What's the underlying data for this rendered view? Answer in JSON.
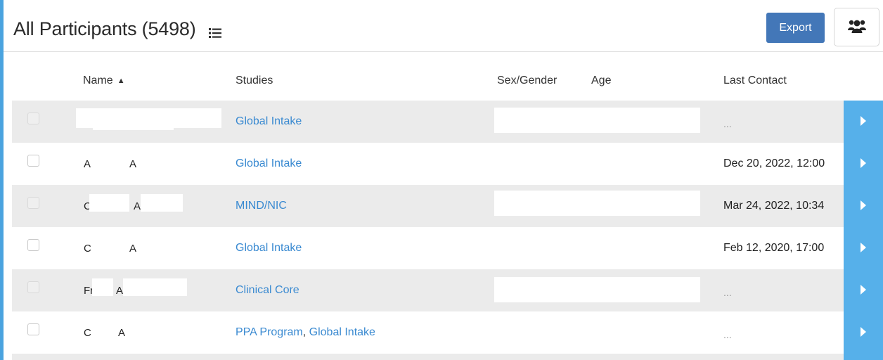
{
  "header": {
    "title": "All Participants (5498)",
    "export_label": "Export"
  },
  "columns": {
    "name": "Name",
    "studies": "Studies",
    "sex_gender": "Sex/Gender",
    "age": "Age",
    "last_contact": "Last Contact"
  },
  "rows": [
    {
      "name_first": "",
      "name_last": "",
      "studies": [
        {
          "label": "Global Intake"
        }
      ],
      "last_contact": "..."
    },
    {
      "name_first": "A",
      "name_last": "A",
      "studies": [
        {
          "label": "Global Intake"
        }
      ],
      "last_contact": "Dec 20, 2022, 12:00"
    },
    {
      "name_first": "C",
      "name_last": "A",
      "studies": [
        {
          "label": "MIND/NIC"
        }
      ],
      "last_contact": "Mar 24, 2022, 10:34"
    },
    {
      "name_first": "C",
      "name_last": "A",
      "studies": [
        {
          "label": "Global Intake"
        }
      ],
      "last_contact": "Feb 12, 2020, 17:00"
    },
    {
      "name_first": "Fr",
      "name_last": "A",
      "studies": [
        {
          "label": "Clinical Core"
        }
      ],
      "last_contact": "..."
    },
    {
      "name_first": "C",
      "name_last": "A",
      "studies": [
        {
          "label": "PPA Program"
        },
        {
          "label": "Global Intake"
        }
      ],
      "studies_separator": ",",
      "last_contact": "..."
    }
  ],
  "icons": {
    "list": "list-icon",
    "users": "users-icon",
    "sort": "sort-asc-icon",
    "open": "chevron-right-icon"
  },
  "colors": {
    "accent": "#4aa3df",
    "export_button": "#4377b8",
    "link": "#3a8ad1",
    "row_action": "#56b0ea",
    "row_shade": "#ebebeb"
  }
}
